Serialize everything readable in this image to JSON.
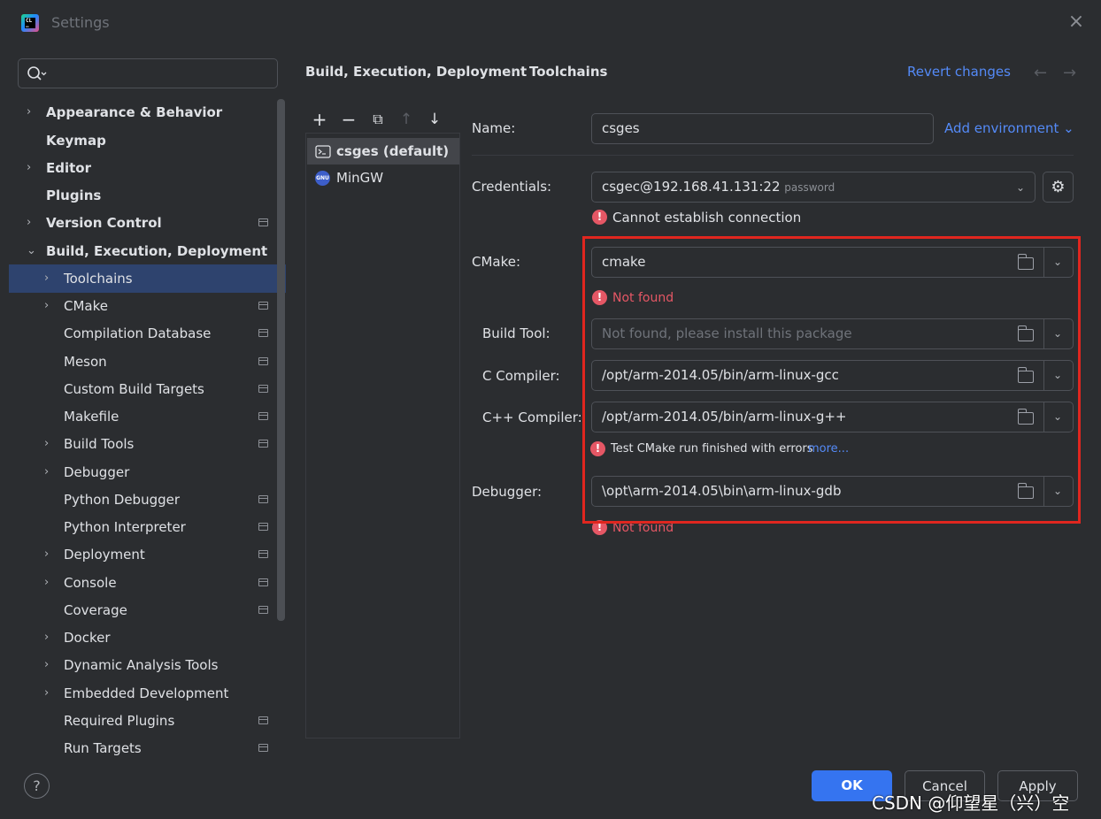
{
  "window": {
    "title": "Settings",
    "close": "×"
  },
  "search": {
    "placeholder": ""
  },
  "sidebar": {
    "items": [
      {
        "label": "Appearance & Behavior"
      },
      {
        "label": "Keymap"
      },
      {
        "label": "Editor"
      },
      {
        "label": "Plugins"
      },
      {
        "label": "Version Control"
      },
      {
        "label": "Build, Execution, Deployment"
      },
      {
        "label": "Toolchains"
      },
      {
        "label": "CMake"
      },
      {
        "label": "Compilation Database"
      },
      {
        "label": "Meson"
      },
      {
        "label": "Custom Build Targets"
      },
      {
        "label": "Makefile"
      },
      {
        "label": "Build Tools"
      },
      {
        "label": "Debugger"
      },
      {
        "label": "Python Debugger"
      },
      {
        "label": "Python Interpreter"
      },
      {
        "label": "Deployment"
      },
      {
        "label": "Console"
      },
      {
        "label": "Coverage"
      },
      {
        "label": "Docker"
      },
      {
        "label": "Dynamic Analysis Tools"
      },
      {
        "label": "Embedded Development"
      },
      {
        "label": "Required Plugins"
      },
      {
        "label": "Run Targets"
      }
    ],
    "help": "?"
  },
  "header": {
    "breadcrumb_1": "Build, Execution, Deployment",
    "breadcrumb_sep": "›",
    "breadcrumb_2": "Toolchains",
    "revert": "Revert changes",
    "back": "←",
    "forward": "→"
  },
  "toolchains": {
    "toolbar": {
      "add": "+",
      "remove": "−",
      "copy": "⧉",
      "up": "↑",
      "down": "↓"
    },
    "list": [
      {
        "name": "csges (default)",
        "icon": "remote-terminal-icon"
      },
      {
        "name": "MinGW",
        "icon": "gnu-icon"
      }
    ]
  },
  "form": {
    "name_label": "Name:",
    "name_value": "csges",
    "add_environment": "Add environment ⌄",
    "credentials_label": "Credentials:",
    "credentials_value": "csgec@192.168.41.131:22",
    "credentials_hint": "password",
    "credentials_error": "Cannot establish connection",
    "cmake_label": "CMake:",
    "cmake_value": "cmake",
    "cmake_error": "Not found",
    "build_tool_label": "Build Tool:",
    "build_tool_placeholder": "Not found, please install this package",
    "c_compiler_label": "C Compiler:",
    "c_compiler_value": "/opt/arm-2014.05/bin/arm-linux-gcc",
    "cpp_compiler_label": "C++ Compiler:",
    "cpp_compiler_value": "/opt/arm-2014.05/bin/arm-linux-g++",
    "cmake_run_error": "Test CMake run finished with errors",
    "cmake_run_more": "more...",
    "debugger_label": "Debugger:",
    "debugger_value": "\\opt\\arm-2014.05\\bin\\arm-linux-gdb",
    "debugger_error": "Not found"
  },
  "footer": {
    "ok": "OK",
    "cancel": "Cancel",
    "apply": "Apply"
  },
  "watermark": "CSDN @仰望星（兴）空"
}
